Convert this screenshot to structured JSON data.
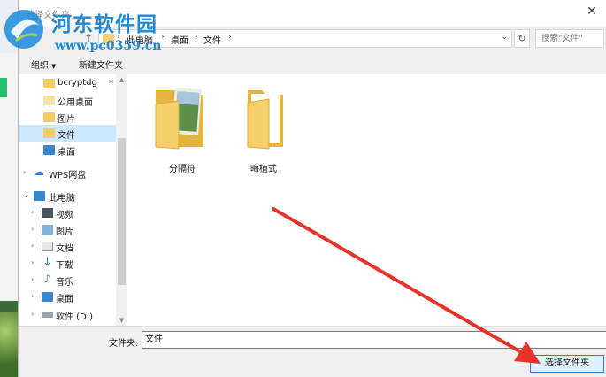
{
  "dialog": {
    "title": "选择文件夹",
    "close_glyph": "✕"
  },
  "watermark": {
    "title": "河东软件园",
    "url": "www.pc0359.cn"
  },
  "address_bar": {
    "crumbs": [
      "此电脑",
      "桌面",
      "文件"
    ],
    "search_placeholder": "搜索\"文件\""
  },
  "toolbar": {
    "organize": "组织",
    "new_folder": "新建文件夹"
  },
  "nav_pane": {
    "items": [
      {
        "label": "bcryptdg",
        "icon": "folder-icon"
      },
      {
        "label": "公用桌面",
        "icon": "folder-icon"
      },
      {
        "label": "图片",
        "icon": "folder-icon"
      },
      {
        "label": "文件",
        "icon": "folder-icon",
        "selected": true
      },
      {
        "label": "桌面",
        "icon": "desktop-icon"
      },
      {
        "label": "WPS网盘",
        "icon": "cloud-icon"
      },
      {
        "label": "此电脑",
        "icon": "computer-icon"
      },
      {
        "label": "视频",
        "icon": "video-icon"
      },
      {
        "label": "图片",
        "icon": "pictures-icon"
      },
      {
        "label": "文档",
        "icon": "documents-icon"
      },
      {
        "label": "下载",
        "icon": "download-icon"
      },
      {
        "label": "音乐",
        "icon": "music-icon"
      },
      {
        "label": "桌面",
        "icon": "desktop-icon"
      },
      {
        "label": "软件 (D:)",
        "icon": "drive-icon"
      }
    ]
  },
  "files": [
    {
      "name": "分隔符",
      "icon": "folder-with-image-icon"
    },
    {
      "name": "晦植式",
      "icon": "folder-icon"
    }
  ],
  "bottom": {
    "folder_label": "文件夹:",
    "folder_value": "文件",
    "select_button": "选择文件夹"
  },
  "colors": {
    "selection": "#cce8ff",
    "accent": "#2a7bd1",
    "annotation_arrow": "#e8332a",
    "watermark": "#1c8ad9"
  }
}
